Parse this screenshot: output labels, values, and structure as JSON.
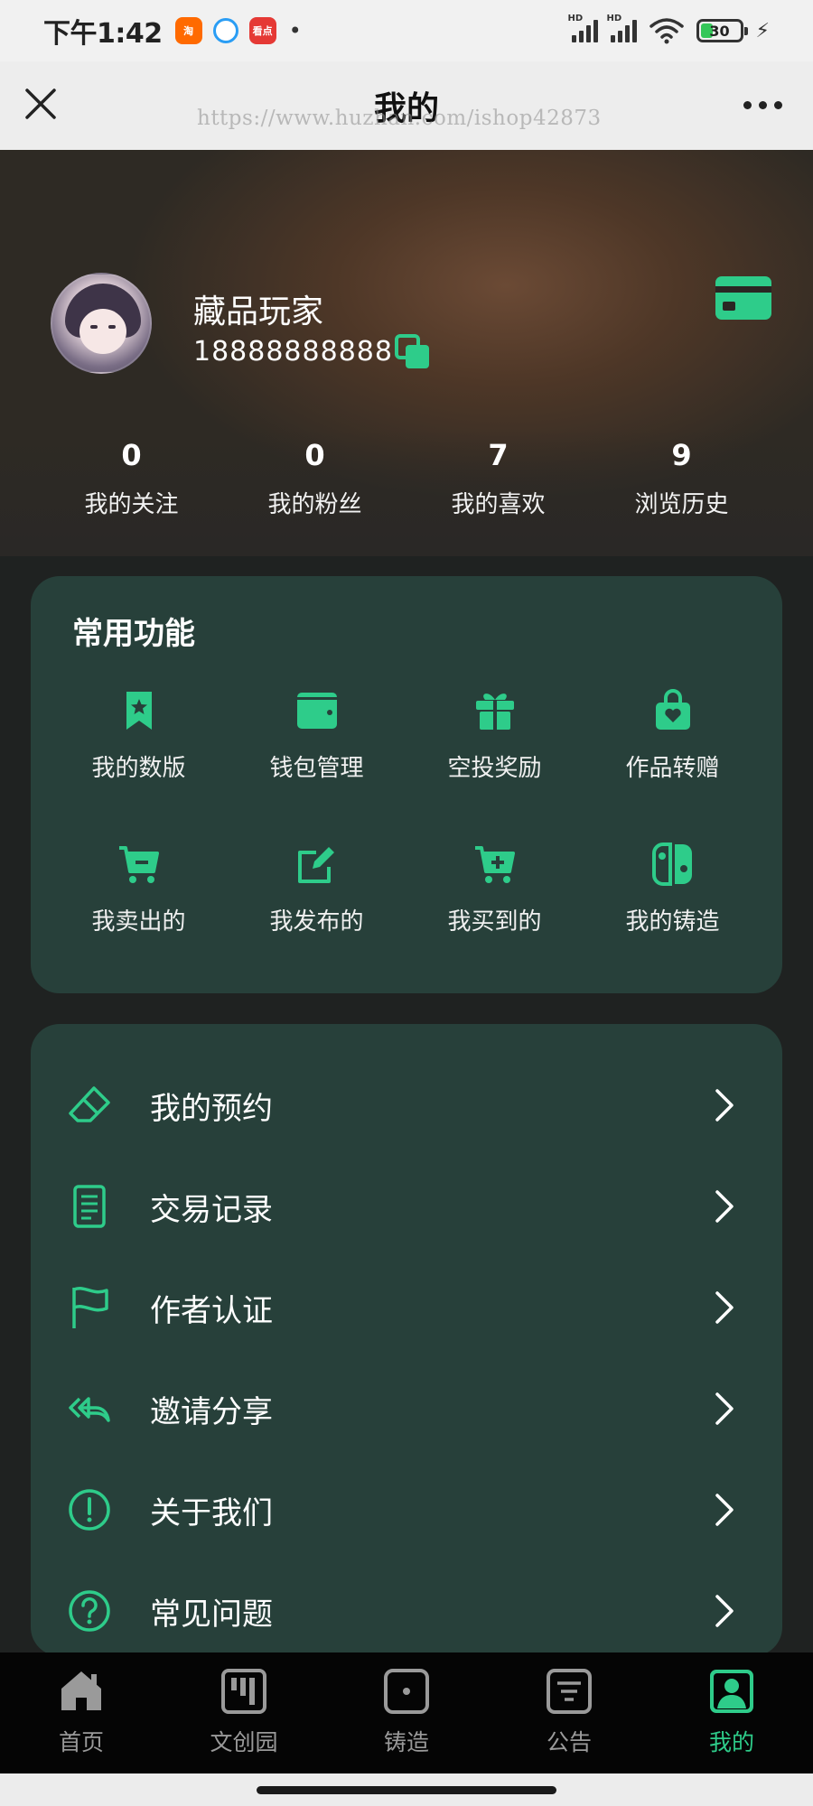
{
  "status_bar": {
    "time": "下午1:42",
    "apps": [
      {
        "name": "taobao-app-icon",
        "label": "淘",
        "color": "#ff6a00"
      },
      {
        "name": "browser-app-icon",
        "label": "",
        "color": "#2a9df4"
      },
      {
        "name": "kandian-app-icon",
        "label": "看点",
        "color": "#e53935"
      }
    ],
    "dot": "•",
    "battery_level": "30"
  },
  "nav": {
    "title": "我的",
    "watermark": "https://www.huzhan.com/ishop42873"
  },
  "profile": {
    "username": "藏品玩家",
    "phone": "18888888888"
  },
  "stats": [
    {
      "value": "0",
      "label": "我的关注"
    },
    {
      "value": "0",
      "label": "我的粉丝"
    },
    {
      "value": "7",
      "label": "我的喜欢"
    },
    {
      "value": "9",
      "label": "浏览历史"
    }
  ],
  "functions": {
    "title": "常用功能",
    "items": [
      {
        "label": "我的数版",
        "icon": "bookmark-star-icon"
      },
      {
        "label": "钱包管理",
        "icon": "wallet-icon"
      },
      {
        "label": "空投奖励",
        "icon": "gift-icon"
      },
      {
        "label": "作品转赠",
        "icon": "shopping-bag-heart-icon"
      },
      {
        "label": "我卖出的",
        "icon": "cart-minus-icon"
      },
      {
        "label": "我发布的",
        "icon": "edit-icon"
      },
      {
        "label": "我买到的",
        "icon": "cart-plus-icon"
      },
      {
        "label": "我的铸造",
        "icon": "switch-console-icon"
      }
    ]
  },
  "menu": [
    {
      "label": "我的预约",
      "icon": "eraser-icon"
    },
    {
      "label": "交易记录",
      "icon": "document-icon"
    },
    {
      "label": "作者认证",
      "icon": "flag-icon"
    },
    {
      "label": "邀请分享",
      "icon": "reply-all-icon"
    },
    {
      "label": "关于我们",
      "icon": "info-exclamation-icon"
    },
    {
      "label": "常见问题",
      "icon": "question-icon"
    }
  ],
  "tabs": [
    {
      "label": "首页",
      "icon": "home-icon",
      "active": false
    },
    {
      "label": "文创园",
      "icon": "kanban-icon",
      "active": false
    },
    {
      "label": "铸造",
      "icon": "dice-icon",
      "active": false
    },
    {
      "label": "公告",
      "icon": "announcement-icon",
      "active": false
    },
    {
      "label": "我的",
      "icon": "user-portrait-icon",
      "active": true
    }
  ],
  "colors": {
    "accent": "#2ecc8a",
    "card_bg": "#27403a",
    "page_bg": "#1f2221",
    "tab_inactive": "#9a9a9a"
  }
}
